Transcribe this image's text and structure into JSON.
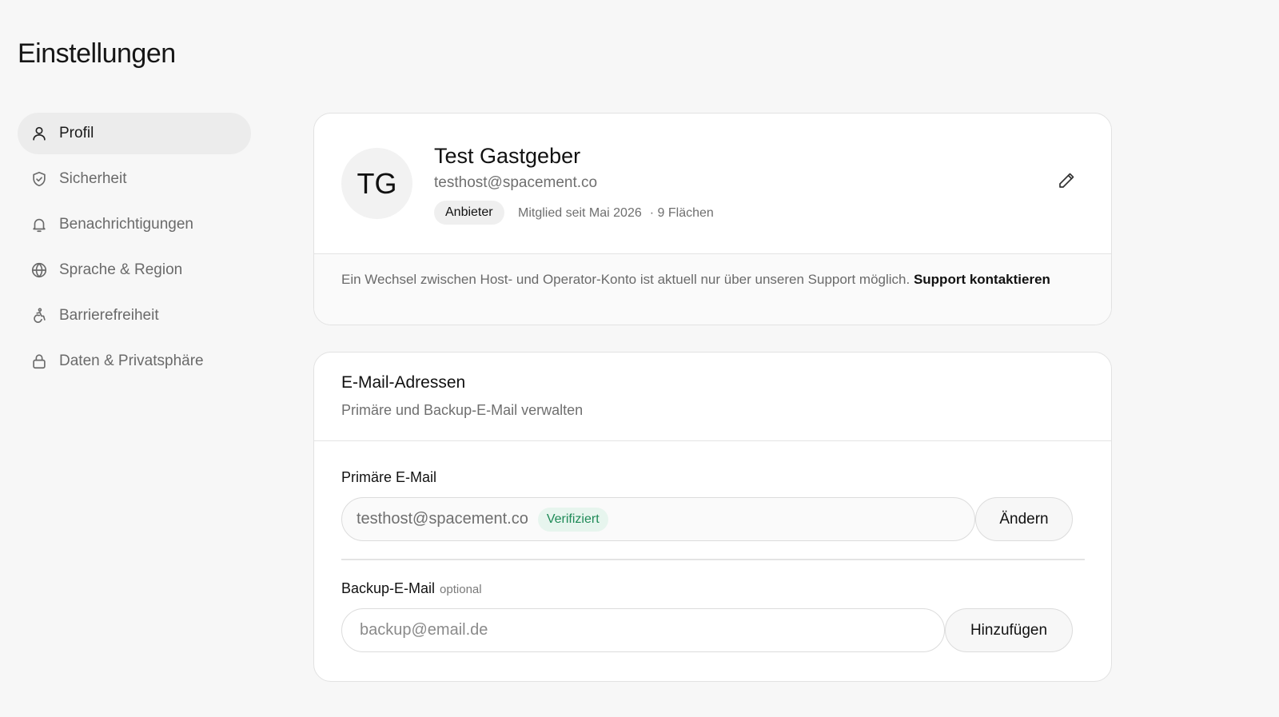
{
  "page": {
    "title": "Einstellungen"
  },
  "sidebar": {
    "items": [
      {
        "label": "Profil",
        "icon": "user-icon",
        "active": true
      },
      {
        "label": "Sicherheit",
        "icon": "shield-icon",
        "active": false
      },
      {
        "label": "Benachrichtigungen",
        "icon": "bell-icon",
        "active": false
      },
      {
        "label": "Sprache & Region",
        "icon": "globe-icon",
        "active": false
      },
      {
        "label": "Barrierefreiheit",
        "icon": "accessibility-icon",
        "active": false
      },
      {
        "label": "Daten & Privatsphäre",
        "icon": "lock-icon",
        "active": false
      }
    ]
  },
  "profile": {
    "initials": "TG",
    "name": "Test Gastgeber",
    "email": "testhost@spacement.co",
    "role": "Anbieter",
    "member_since": "Mitglied seit Mai 2026",
    "spaces": "· 9 Flächen",
    "edit_icon": "pencil-icon",
    "note_text": "Ein Wechsel zwischen Host- und Operator-Konto ist aktuell nur über unseren Support möglich.",
    "support_link": "Support kontaktieren"
  },
  "emails": {
    "title": "E-Mail-Adressen",
    "subtitle": "Primäre und Backup-E-Mail verwalten",
    "primary": {
      "label": "Primäre E-Mail",
      "value": "testhost@spacement.co",
      "status": "Verifiziert",
      "button": "Ändern"
    },
    "backup": {
      "label": "Backup-E-Mail",
      "optional": "optional",
      "placeholder": "backup@email.de",
      "button": "Hinzufügen"
    }
  },
  "colors": {
    "background": "#f7f7f7",
    "card": "#ffffff",
    "active_nav": "#ececec",
    "verified_bg": "#e7f5ee",
    "verified_text": "#1e8a57"
  }
}
